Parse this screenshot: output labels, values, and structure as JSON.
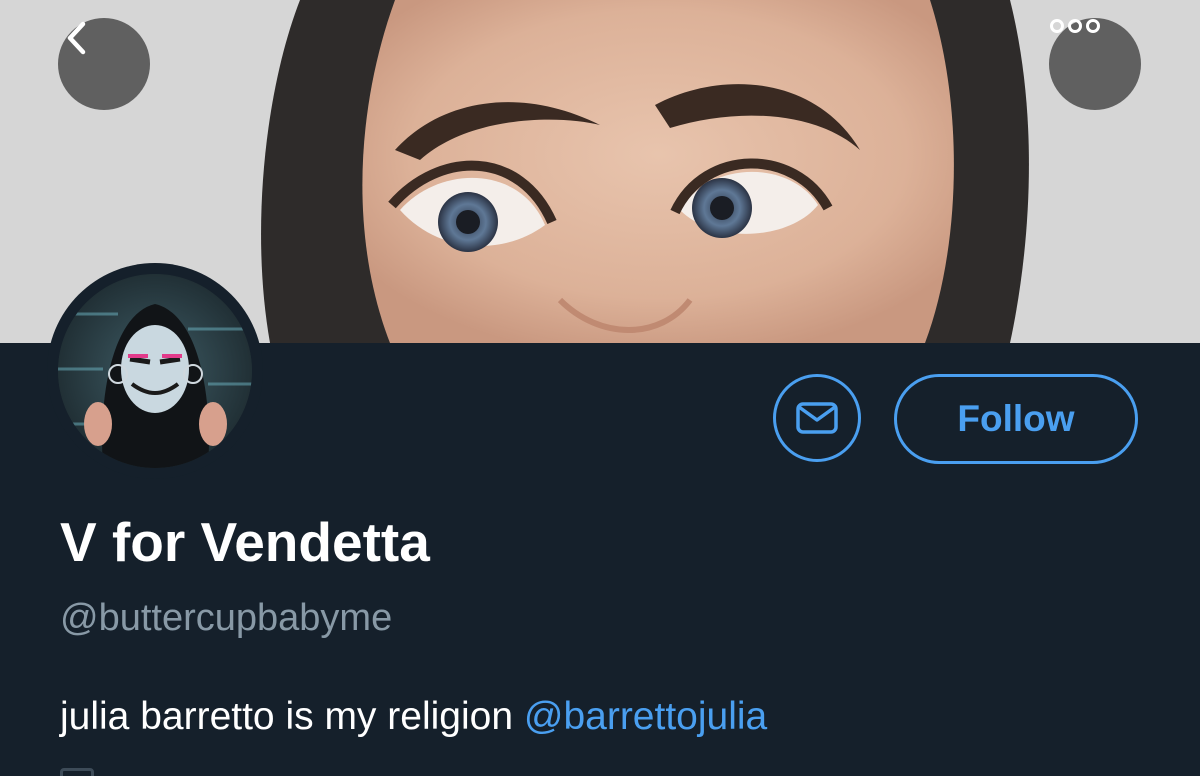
{
  "header": {
    "back_icon": "chevron-left-icon",
    "more_icon": "more-horizontal-icon"
  },
  "profile": {
    "display_name": "V for Vendetta",
    "handle": "@buttercupbabyme",
    "bio_text": "julia barretto is my religion ",
    "bio_mention": "@barrettojulia",
    "follow_label": "Follow",
    "message_icon": "envelope-icon"
  },
  "colors": {
    "background": "#15202b",
    "accent": "#4a9ff0",
    "secondary_text": "#8899a6",
    "primary_text": "#ffffff"
  }
}
